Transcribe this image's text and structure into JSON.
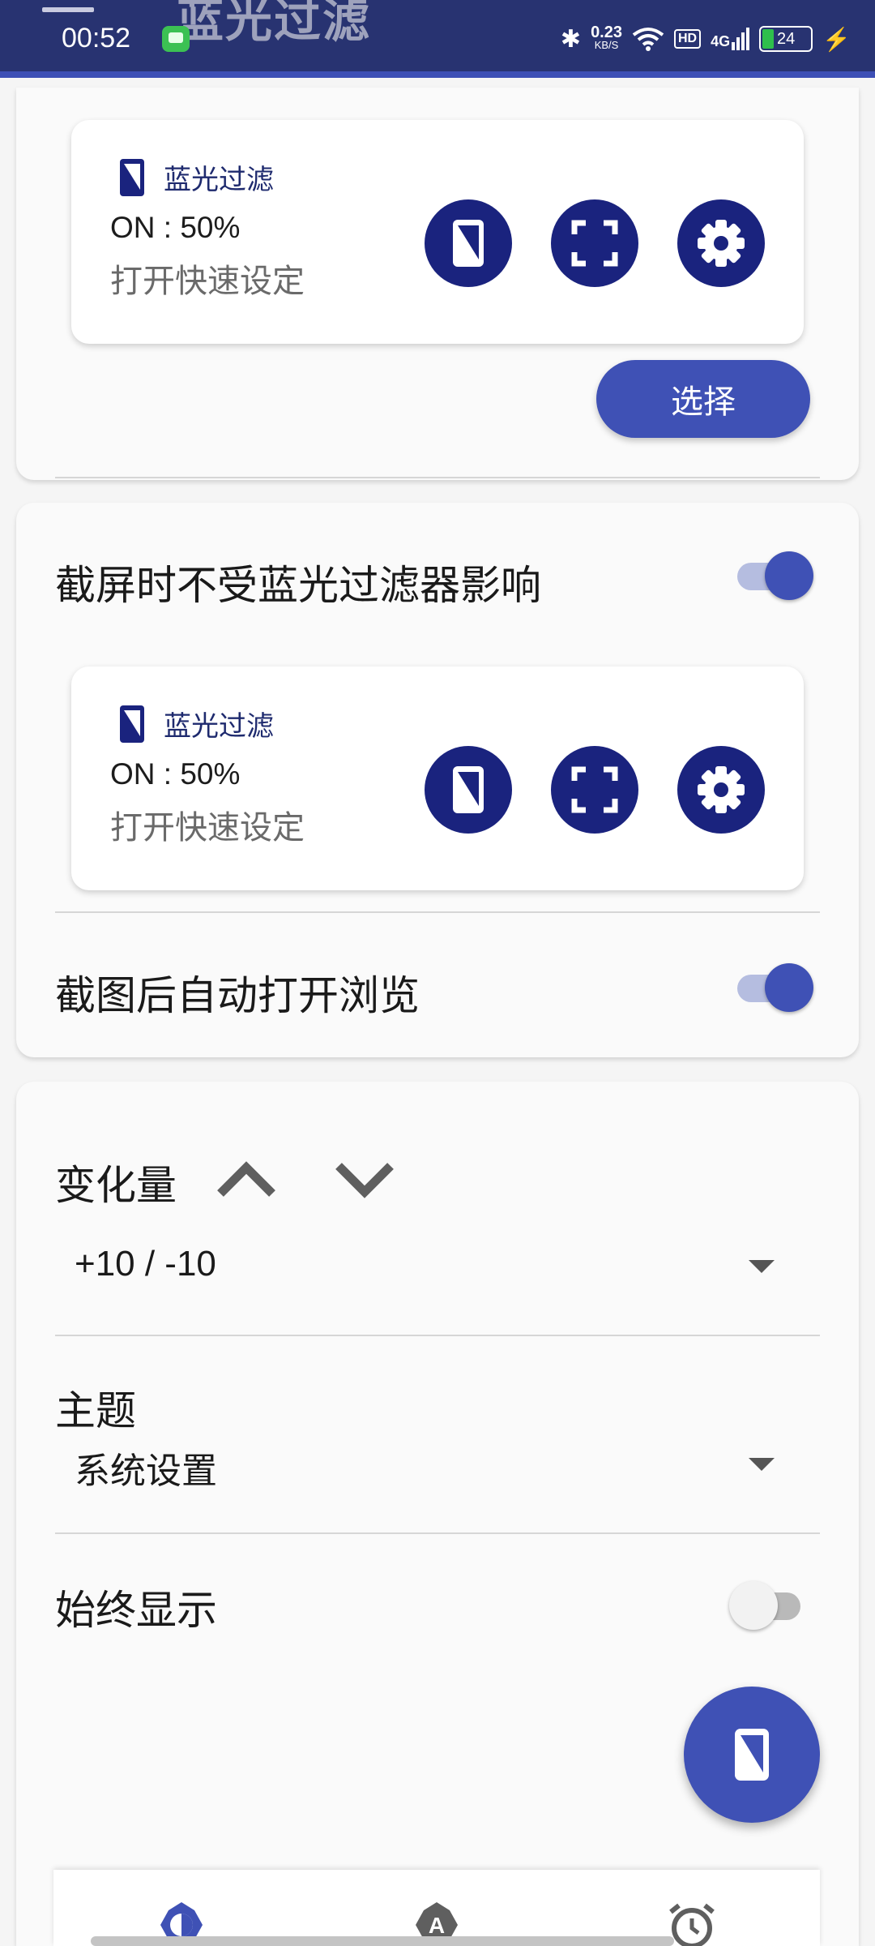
{
  "status_bar": {
    "time": "00:52",
    "net_speed_value": "0.23",
    "net_speed_unit": "KB/S",
    "hd_label": "HD",
    "signal_label": "4G",
    "battery_level": "24"
  },
  "app_bar": {
    "title": "蓝光过滤"
  },
  "widget_preview": {
    "title": "蓝光过滤",
    "status": "ON : 50%",
    "subtitle": "打开快速设定"
  },
  "card1": {
    "select_button_label": "选择"
  },
  "card2": {
    "screenshot_unaffected_label": "截屏时不受蓝光过滤器影响",
    "screenshot_unaffected_enabled": true,
    "auto_open_preview_label": "截图后自动打开浏览",
    "auto_open_preview_enabled": true
  },
  "card3": {
    "step_label": "变化量",
    "step_value": "+10 / -10",
    "theme_label": "主题",
    "theme_value": "系统设置",
    "always_show_label": "始终显示",
    "always_show_enabled": false
  },
  "colors": {
    "primary": "#3f51b5",
    "primary_dark": "#1a237e",
    "app_bar": "#283371"
  },
  "bottom_nav": {
    "items": [
      "brightness-icon",
      "auto-mode-icon",
      "alarm-clock-icon"
    ]
  }
}
